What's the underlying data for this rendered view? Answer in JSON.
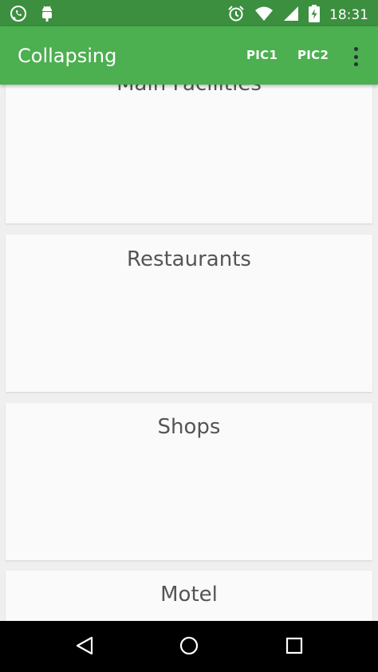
{
  "status_bar": {
    "time": "18:31",
    "left_icons": [
      "whatsapp-icon",
      "android-debug-icon"
    ],
    "right_icons": [
      "alarm-icon",
      "wifi-icon",
      "cell-signal-icon",
      "battery-charging-icon"
    ]
  },
  "app_bar": {
    "title": "Collapsing",
    "actions": [
      "PIC1",
      "PIC2"
    ],
    "overflow_icon": "more-vert-icon",
    "color": "#4caf50"
  },
  "cards": [
    {
      "label": "Main Facilities"
    },
    {
      "label": "Restaurants"
    },
    {
      "label": "Shops"
    },
    {
      "label": "Motel"
    }
  ],
  "nav_bar": {
    "icons": [
      "back-icon",
      "home-icon",
      "recents-icon"
    ]
  }
}
